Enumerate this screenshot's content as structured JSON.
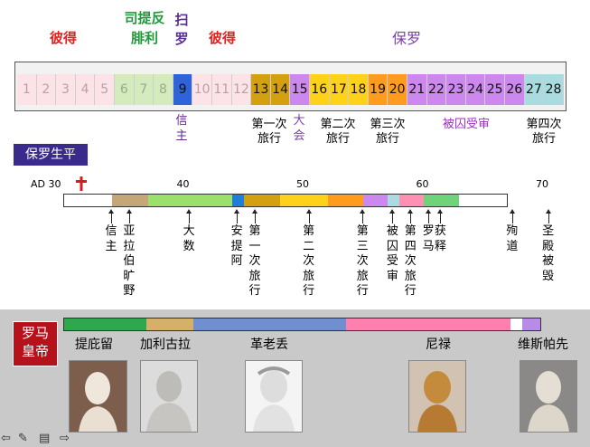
{
  "colors": {
    "peter": "#e2201f",
    "james_philip": "#1e9a3a",
    "saul": "#5a2d91",
    "paul": "#7b3fb0",
    "cell_pink": "#fbe3e8",
    "cell_light_green": "#cde8b4",
    "cell_blue": "#2e5fd8",
    "cell_gold": "#d3a10f",
    "cell_yellow": "#ffd21a",
    "cell_orange": "#ff9b1f",
    "cell_purple": "#cc88ee",
    "cell_teal": "#a8dce0",
    "title_box": "#3a2a8c",
    "emperor_box": "#b5121b"
  },
  "top_groups": {
    "peter_left": "彼得",
    "james_philip_line1": "司提反",
    "james_philip_line2": "腓利",
    "saul_line1": "扫",
    "saul_line2": "罗",
    "peter_right": "彼得",
    "paul": "保罗"
  },
  "cells": [
    {
      "n": "1",
      "bg": "#fbe3e8",
      "fg": "#b7a0a6"
    },
    {
      "n": "2",
      "bg": "#fbe3e8",
      "fg": "#b7a0a6"
    },
    {
      "n": "3",
      "bg": "#fbe3e8",
      "fg": "#b7a0a6"
    },
    {
      "n": "4",
      "bg": "#fbe3e8",
      "fg": "#b7a0a6"
    },
    {
      "n": "5",
      "bg": "#fbe3e8",
      "fg": "#b7a0a6"
    },
    {
      "n": "6",
      "bg": "#d4ebbd",
      "fg": "#9aaa8d"
    },
    {
      "n": "7",
      "bg": "#d4ebbd",
      "fg": "#9aaa8d"
    },
    {
      "n": "8",
      "bg": "#d4ebbd",
      "fg": "#9aaa8d"
    },
    {
      "n": "9",
      "bg": "#2f63d9",
      "fg": "#111111"
    },
    {
      "n": "10",
      "bg": "#fbe3e8",
      "fg": "#b7a0a6"
    },
    {
      "n": "11",
      "bg": "#fbe3e8",
      "fg": "#b7a0a6"
    },
    {
      "n": "12",
      "bg": "#fbe3e8",
      "fg": "#b7a0a6"
    },
    {
      "n": "13",
      "bg": "#d3a10f",
      "fg": "#111111"
    },
    {
      "n": "14",
      "bg": "#d3a10f",
      "fg": "#111111"
    },
    {
      "n": "15",
      "bg": "#cc88ee",
      "fg": "#111111"
    },
    {
      "n": "16",
      "bg": "#ffd21a",
      "fg": "#111111"
    },
    {
      "n": "17",
      "bg": "#ffd21a",
      "fg": "#111111"
    },
    {
      "n": "18",
      "bg": "#ffd21a",
      "fg": "#111111"
    },
    {
      "n": "19",
      "bg": "#ff9b1f",
      "fg": "#111111"
    },
    {
      "n": "20",
      "bg": "#ff9b1f",
      "fg": "#111111"
    },
    {
      "n": "21",
      "bg": "#cc88ee",
      "fg": "#111111"
    },
    {
      "n": "22",
      "bg": "#cc88ee",
      "fg": "#111111"
    },
    {
      "n": "23",
      "bg": "#cc88ee",
      "fg": "#111111"
    },
    {
      "n": "24",
      "bg": "#cc88ee",
      "fg": "#111111"
    },
    {
      "n": "25",
      "bg": "#cc88ee",
      "fg": "#111111"
    },
    {
      "n": "26",
      "bg": "#cc88ee",
      "fg": "#111111"
    },
    {
      "n": "27",
      "bg": "#a8dce0",
      "fg": "#111111"
    },
    {
      "n": "28",
      "bg": "#a8dce0",
      "fg": "#111111"
    }
  ],
  "strip_labels": {
    "believe": "信主",
    "journey1_line1": "第一次",
    "journey1_line2": "旅行",
    "council_line1": "大",
    "council_line2": "会",
    "journey2_line1": "第二次",
    "journey2_line2": "旅行",
    "journey3_line1": "第三次",
    "journey3_line2": "旅行",
    "imprisoned": "被囚受审",
    "journey4_line1": "第四次",
    "journey4_line2": "旅行"
  },
  "section_title": "保罗生平",
  "timeline": {
    "start_label": "AD 30",
    "cross_icon": "cross-icon",
    "ticks": [
      "40",
      "50",
      "60",
      "70"
    ],
    "segments": [
      {
        "from": 30,
        "to": 34,
        "color": "#ffffff"
      },
      {
        "from": 34,
        "to": 37,
        "color": "#c4a678"
      },
      {
        "from": 37,
        "to": 44,
        "color": "#9be06a"
      },
      {
        "from": 44,
        "to": 45,
        "color": "#1e7fd8"
      },
      {
        "from": 45,
        "to": 48,
        "color": "#d3a10f"
      },
      {
        "from": 48,
        "to": 52,
        "color": "#ffd21a"
      },
      {
        "from": 52,
        "to": 55,
        "color": "#ff9b1f"
      },
      {
        "from": 55,
        "to": 57,
        "color": "#cc88ee"
      },
      {
        "from": 57,
        "to": 58,
        "color": "#a8dce0"
      },
      {
        "from": 58,
        "to": 60,
        "color": "#ff8fb3"
      },
      {
        "from": 60,
        "to": 63,
        "color": "#6fd37a"
      },
      {
        "from": 63,
        "to": 67,
        "color": "#ffffff"
      }
    ],
    "events": [
      {
        "label": "信主",
        "year": 34
      },
      {
        "label": "亚拉伯旷野",
        "year": 35.5
      },
      {
        "label": "大数",
        "year": 40.5
      },
      {
        "label": "安提阿",
        "year": 44.5
      },
      {
        "label": "第一次旅行",
        "year": 46
      },
      {
        "label": "第二次旅行",
        "year": 50.5
      },
      {
        "label": "第三次旅行",
        "year": 55
      },
      {
        "label": "被囚受审",
        "year": 57.5
      },
      {
        "label": "第四次旅行",
        "year": 59
      },
      {
        "label": "罗马",
        "year": 60.5
      },
      {
        "label": "获释",
        "year": 61.5
      },
      {
        "label": "殉道",
        "year": 67.5
      },
      {
        "label": "圣殿被毁",
        "year": 70.5
      }
    ]
  },
  "emperors": {
    "title_line1": "罗马",
    "title_line2": "皇帝",
    "segments": [
      {
        "from": 30,
        "to": 37,
        "color": "#2ea84f"
      },
      {
        "from": 37,
        "to": 41,
        "color": "#d4b068"
      },
      {
        "from": 41,
        "to": 54,
        "color": "#6f8fd0"
      },
      {
        "from": 54,
        "to": 68,
        "color": "#ff7fae"
      },
      {
        "from": 68,
        "to": 69,
        "color": "#ffffff"
      },
      {
        "from": 69,
        "to": 70.5,
        "color": "#b98be8"
      }
    ],
    "names": [
      {
        "label": "提庇留",
        "portrait": "tiberius-bust"
      },
      {
        "label": "加利古拉",
        "portrait": "caligula-bust"
      },
      {
        "label": "革老丢",
        "portrait": "claudius-bust"
      },
      {
        "label": "尼禄",
        "portrait": "nero-bust"
      },
      {
        "label": "维斯帕先",
        "portrait": "vespasian-bust"
      }
    ]
  },
  "controls": [
    "back-arrow-icon",
    "pen-icon",
    "menu-icon",
    "forward-arrow-icon"
  ]
}
